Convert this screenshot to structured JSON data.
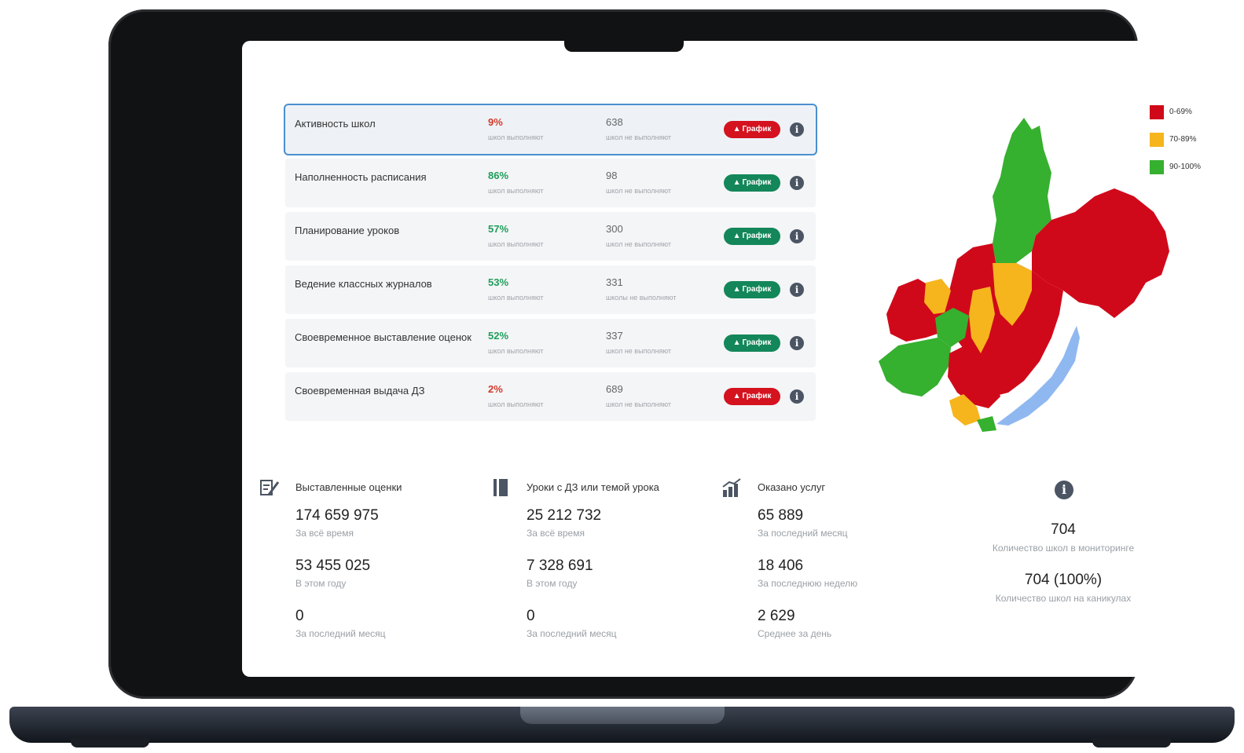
{
  "colors": {
    "red": "#d0091a",
    "yellow": "#f6b51d",
    "green": "#36b02f",
    "lake": "#8fb8f0",
    "button_red": "#d4131f",
    "button_green": "#13875a",
    "pct_red": "#d23a2a",
    "pct_green": "#1e9e5a"
  },
  "metrics": [
    {
      "name": "Активность школ",
      "percent": "9%",
      "percent_color": "red",
      "percent_sub": "школ выполняют",
      "count": "638",
      "count_sub": "школ не выполняют",
      "button_label": "График",
      "button_color": "red",
      "active": true
    },
    {
      "name": "Наполненность расписания",
      "percent": "86%",
      "percent_color": "green",
      "percent_sub": "школ выполняют",
      "count": "98",
      "count_sub": "школ не выполняют",
      "button_label": "График",
      "button_color": "green"
    },
    {
      "name": "Планирование уроков",
      "percent": "57%",
      "percent_color": "green",
      "percent_sub": "школ выполняют",
      "count": "300",
      "count_sub": "школ не выполняют",
      "button_label": "График",
      "button_color": "green"
    },
    {
      "name": "Ведение классных журналов",
      "percent": "53%",
      "percent_color": "green",
      "percent_sub": "школ выполняют",
      "count": "331",
      "count_sub": "школы не выполняют",
      "button_label": "График",
      "button_color": "green"
    },
    {
      "name": "Своевременное выставление оценок",
      "percent": "52%",
      "percent_color": "green",
      "percent_sub": "школ выполняют",
      "count": "337",
      "count_sub": "школ не выполняют",
      "button_label": "График",
      "button_color": "green"
    },
    {
      "name": "Своевременная выдача ДЗ",
      "percent": "2%",
      "percent_color": "red",
      "percent_sub": "школ выполняют",
      "count": "689",
      "count_sub": "школ не выполняют",
      "button_label": "График",
      "button_color": "red"
    }
  ],
  "legend": [
    {
      "label": "0-69%",
      "color": "#d0091a"
    },
    {
      "label": "70-89%",
      "color": "#f6b51d"
    },
    {
      "label": "90-100%",
      "color": "#36b02f"
    }
  ],
  "stats": [
    {
      "title": "Выставленные оценки",
      "icon": "grades-icon",
      "items": [
        {
          "value": "174 659 975",
          "label": "За всё время"
        },
        {
          "value": "53 455 025",
          "label": "В этом году"
        },
        {
          "value": "0",
          "label": "За последний месяц"
        }
      ]
    },
    {
      "title": "Уроки с ДЗ или темой урока",
      "icon": "book-icon",
      "items": [
        {
          "value": "25 212 732",
          "label": "За всё время"
        },
        {
          "value": "7 328 691",
          "label": "В этом году"
        },
        {
          "value": "0",
          "label": "За последний месяц"
        }
      ]
    },
    {
      "title": "Оказано услуг",
      "icon": "growth-chart-icon",
      "items": [
        {
          "value": "65 889",
          "label": "За последний месяц"
        },
        {
          "value": "18 406",
          "label": "За последнюю неделю"
        },
        {
          "value": "2 629",
          "label": "Среднее за день"
        }
      ]
    }
  ],
  "summary": {
    "schools_count": "704",
    "schools_count_label": "Количество школ в мониторинге",
    "vacation": "704 (100%)",
    "vacation_label": "Количество школ на каникулах"
  }
}
